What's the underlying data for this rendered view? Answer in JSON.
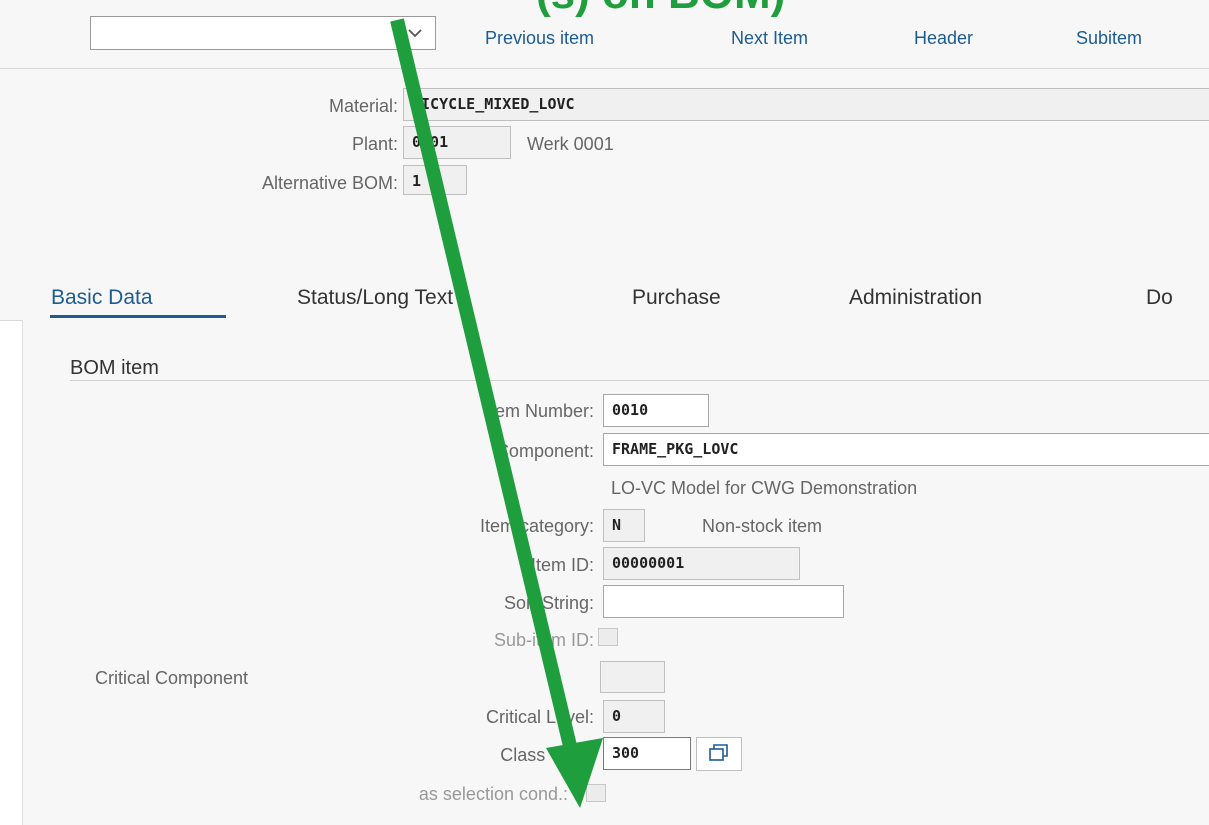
{
  "toolbar": {
    "dropdown_value": "",
    "previous_item": "Previous item",
    "next_item": "Next Item",
    "header": "Header",
    "subitem": "Subitem"
  },
  "header": {
    "material_label": "Material:",
    "material_value": "BICYCLE_MIXED_LOVC",
    "plant_label": "Plant:",
    "plant_value": "0001",
    "plant_desc": "Werk 0001",
    "alt_bom_label": "Alternative BOM:",
    "alt_bom_value": "1"
  },
  "tabs": [
    "Basic Data",
    "Status/Long Text",
    "Purchase",
    "Administration",
    "Do"
  ],
  "section": {
    "title": "BOM item",
    "item_number_label": "Item Number:",
    "item_number_value": "0010",
    "component_label": "Component:",
    "component_value": "FRAME_PKG_LOVC",
    "component_desc": "LO-VC Model for CWG Demonstration",
    "item_category_label": "Item category:",
    "item_category_value": "N",
    "item_category_desc": "Non-stock item",
    "item_id_label": "Item ID:",
    "item_id_value": "00000001",
    "sort_string_label": "Sort String:",
    "sort_string_value": "",
    "sub_item_id_label": "Sub-item ID:",
    "critical_component_label": "Critical Component",
    "critical_level_label": "Critical Level:",
    "critical_level_value": "0",
    "class_type_label": "Class Type:",
    "class_type_value": "300",
    "selection_cond_label": "as selection cond.:"
  },
  "overlay": {
    "arrow_color": "#1f9e3d",
    "title_fragment": "(s) on BOM)"
  },
  "colors": {
    "link": "#1d5c91",
    "background": "#f7f7f7"
  }
}
